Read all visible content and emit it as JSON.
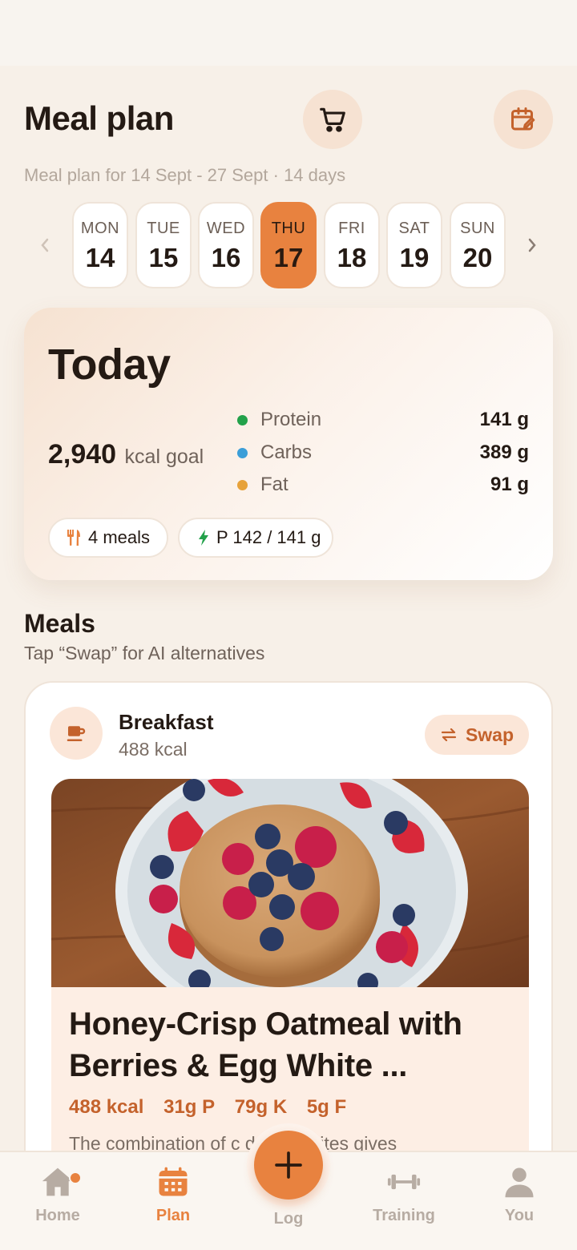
{
  "header": {
    "title": "Meal plan",
    "subtitle": "Meal plan for 14 Sept - 27 Sept · 14 days",
    "cart_icon": "cart-icon",
    "calendar_icon": "calendar-edit-icon"
  },
  "week": {
    "days": [
      {
        "dow": "MON",
        "date": "14"
      },
      {
        "dow": "TUE",
        "date": "15"
      },
      {
        "dow": "WED",
        "date": "16"
      },
      {
        "dow": "THU",
        "date": "17"
      },
      {
        "dow": "FRI",
        "date": "18"
      },
      {
        "dow": "SAT",
        "date": "19"
      },
      {
        "dow": "SUN",
        "date": "20"
      }
    ],
    "selected": "THU 17"
  },
  "today": {
    "title": "Today",
    "kcal_value": "2,940",
    "kcal_unit": "kcal goal",
    "macros": [
      {
        "label": "Protein",
        "value": "141 g",
        "color": "#22a14a"
      },
      {
        "label": "Carbs",
        "value": "389 g",
        "color": "#3b9ed8"
      },
      {
        "label": "Fat",
        "value": "91 g",
        "color": "#e7a23a"
      }
    ],
    "pills": {
      "meals": "4 meals",
      "protein": "P 142 / 141 g"
    }
  },
  "meals_section": {
    "heading": "Meals",
    "subheading": "Tap “Swap” for AI alternatives"
  },
  "meal_card": {
    "name": "Breakfast",
    "kcal": "488 kcal",
    "swap_label": "Swap",
    "recipe_title": "Honey-Crisp Oatmeal with Berries & Egg White ...",
    "macros": [
      "488 kcal",
      "31g P",
      "79g K",
      "5g F"
    ],
    "description": "The combination of c        d egg whites gives"
  },
  "nav": {
    "home": "Home",
    "plan": "Plan",
    "log": "Log",
    "training": "Training",
    "you": "You"
  },
  "colors": {
    "accent": "#e8823f",
    "accent_text": "#c4622c",
    "background": "#f7f0e8"
  }
}
